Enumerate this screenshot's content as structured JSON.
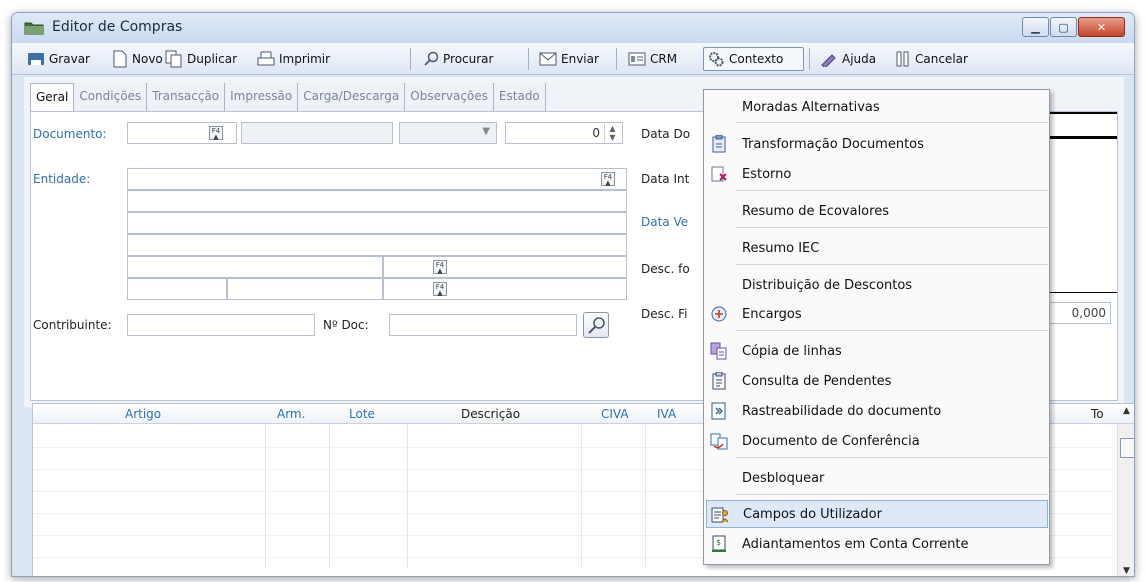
{
  "window": {
    "title": "Editor de Compras"
  },
  "toolbar": {
    "gravar": "Gravar",
    "novo": "Novo",
    "duplicar": "Duplicar",
    "imprimir": "Imprimir",
    "procurar": "Procurar",
    "enviar": "Enviar",
    "crm": "CRM",
    "contexto": "Contexto",
    "ajuda": "Ajuda",
    "cancelar": "Cancelar"
  },
  "tabs": [
    "Geral",
    "Condições",
    "Transacção",
    "Impressão",
    "Carga/Descarga",
    "Observações",
    "Estado"
  ],
  "form": {
    "documento_label": "Documento:",
    "documento_number": "0",
    "entidade_label": "Entidade:",
    "data_doc_label": "Data Do",
    "data_int_label": "Data Int",
    "data_venc_label": "Data Ve",
    "desc_fo_label": "Desc. fo",
    "desc_fi_label": "Desc. Fi",
    "desc_value": "0,000",
    "contribuinte_label": "Contribuinte:",
    "ndoc_label": "Nº Doc:"
  },
  "grid": {
    "columns": [
      "Artigo",
      "Arm.",
      "Lote",
      "Descrição",
      "CIVA",
      "IVA",
      "To"
    ]
  },
  "context_menu": {
    "items": [
      {
        "label": "Moradas Alternativas",
        "icon": "none"
      },
      {
        "label": "Transformação Documentos",
        "icon": "document-transform-icon"
      },
      {
        "label": "Estorno",
        "icon": "reverse-document-icon"
      },
      {
        "label": "Resumo de Ecovalores",
        "icon": "none"
      },
      {
        "label": "Resumo IEC",
        "icon": "none"
      },
      {
        "label": "Distribuição de Descontos",
        "icon": "none"
      },
      {
        "label": "Encargos",
        "icon": "charges-icon"
      },
      {
        "label": "Cópia de linhas",
        "icon": "copy-lines-icon"
      },
      {
        "label": "Consulta de Pendentes",
        "icon": "clipboard-icon"
      },
      {
        "label": "Rastreabilidade do documento",
        "icon": "traceability-icon"
      },
      {
        "label": "Documento de Conferência",
        "icon": "conference-doc-icon"
      },
      {
        "label": "Desbloquear",
        "icon": "none"
      },
      {
        "label": "Campos do Utilizador",
        "icon": "user-fields-icon"
      },
      {
        "label": "Adiantamentos em Conta Corrente",
        "icon": "advance-payments-icon"
      }
    ]
  }
}
